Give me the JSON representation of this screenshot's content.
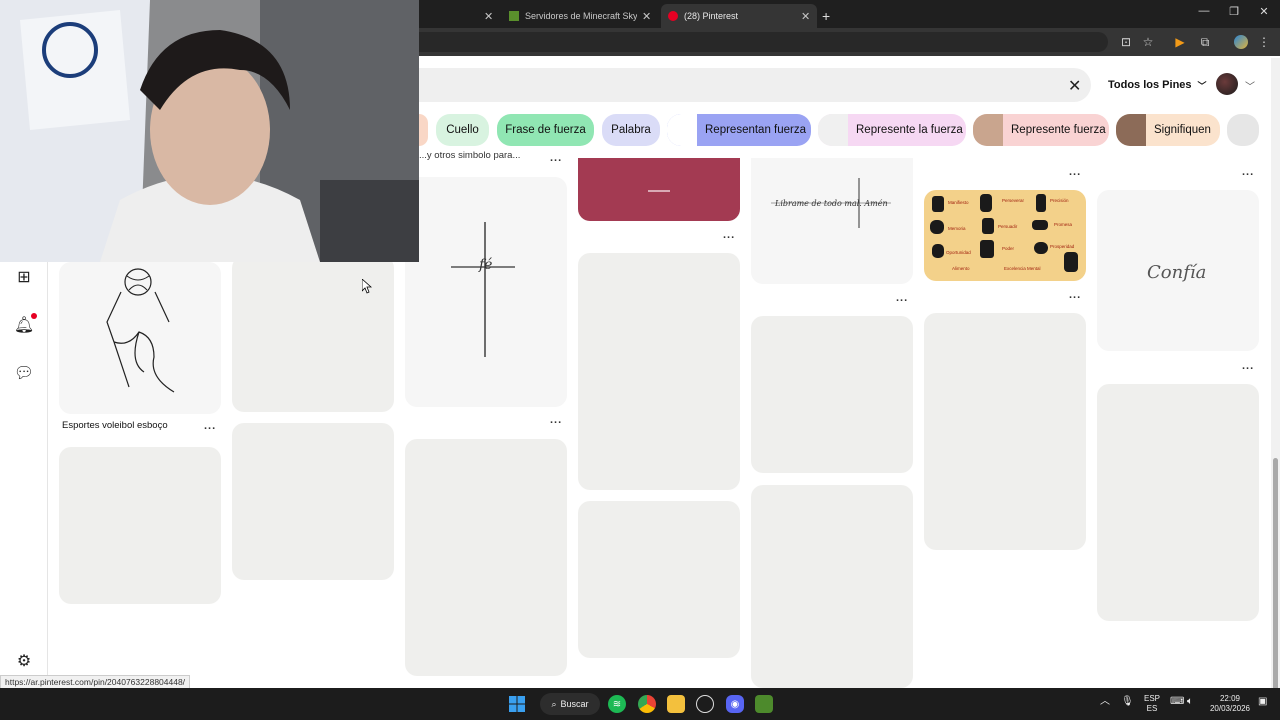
{
  "browser": {
    "tabs": [
      {
        "label": "Servidores de Minecraft Skywar",
        "active": false
      },
      {
        "label": "(28) Pinterest",
        "active": true
      }
    ],
    "new_tab": "+"
  },
  "header": {
    "filter_label": "Todos los Pines",
    "clear_icon": "✕"
  },
  "chips": [
    {
      "label": "Cuello",
      "color": "#d8f3e0"
    },
    {
      "label": "Frase de fuerza",
      "color": "#90e6b3"
    },
    {
      "label": "Palabra",
      "color": "#dadcf7"
    },
    {
      "label": "Representan fuerza",
      "color": "#9aa3f3"
    },
    {
      "label": "Represente la fuerza",
      "color": "#f6d8f3"
    },
    {
      "label": "Represente fuerza",
      "color": "#f9d3d3"
    },
    {
      "label": "Signifiquen",
      "color": "#fbe3cd"
    }
  ],
  "pins": {
    "voleibol_title": "Esportes voleibol esboço",
    "partial_title": "...y otros simbolo para...",
    "fe_text": "fé",
    "confia_text": "Confía",
    "script_text": "Librame de todo mal. Amén",
    "symbols_labels": [
      "Manifiesto",
      "Perseverar",
      "Precisión",
      "Memoria",
      "Persuadir",
      "Promesa",
      "Oportunidad",
      "Poder",
      "Prosperidad",
      "Alimento",
      "Excelencia Mental"
    ],
    "more": "..."
  },
  "status_url": "https://ar.pinterest.com/pin/2040763228804448/",
  "taskbar": {
    "search_label": "Buscar",
    "lang_top": "ESP",
    "lang_bottom": "ES",
    "time": "22:09",
    "date": "20/03/2026"
  },
  "colors": {
    "accent_red": "#e60023",
    "pin_placeholder": "#efefed",
    "maroon_pin": "#a33a52",
    "symbols_pin": "#f3d18a"
  }
}
